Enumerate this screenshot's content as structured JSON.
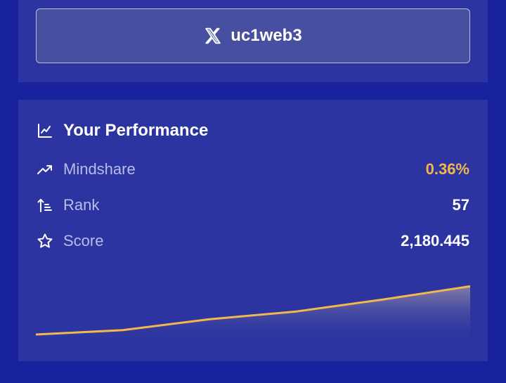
{
  "colors": {
    "background": "#17229c",
    "card": "#2b34a0",
    "accent": "#f2b84b",
    "text": "#ffffff",
    "muted": "#b8bde8"
  },
  "profile": {
    "icon": "x-logo-icon",
    "handle": "uc1web3"
  },
  "performance": {
    "icon": "line-chart-icon",
    "title": "Your Performance",
    "stats": [
      {
        "icon": "trending-up-icon",
        "label": "Mindshare",
        "value": "0.36%"
      },
      {
        "icon": "rank-sort-icon",
        "label": "Rank",
        "value": "57"
      },
      {
        "icon": "star-icon",
        "label": "Score",
        "value": "2,180.445"
      }
    ]
  },
  "chart_data": {
    "type": "area",
    "x": [
      0,
      1,
      2,
      3,
      4,
      5
    ],
    "values": [
      0,
      8,
      28,
      42,
      64,
      88
    ],
    "ylim": [
      0,
      100
    ],
    "line_color": "#f2b84b",
    "grid": false,
    "axes": false
  }
}
